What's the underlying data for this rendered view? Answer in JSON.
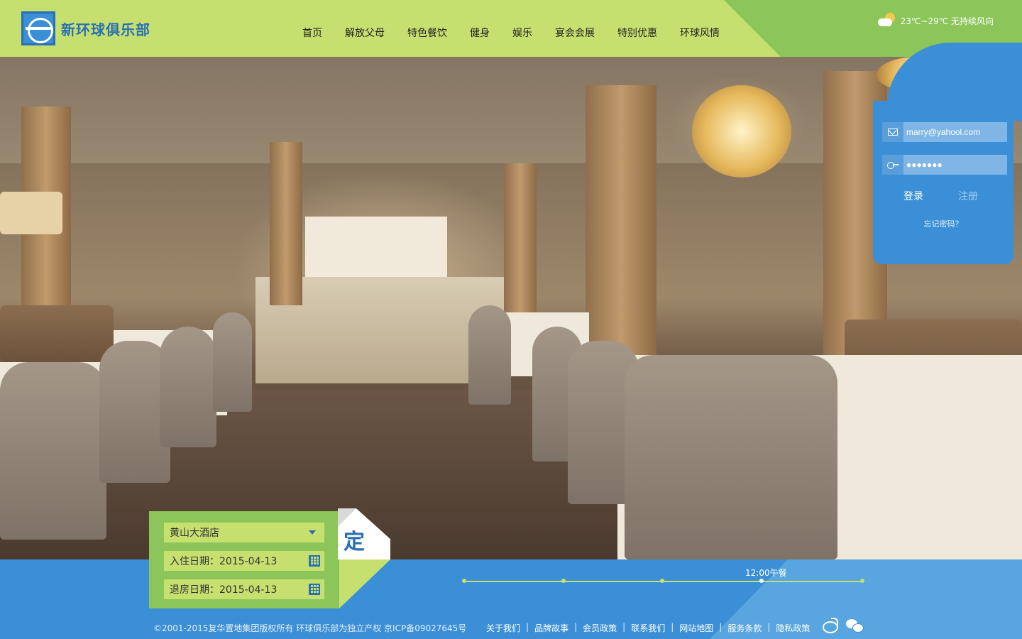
{
  "header": {
    "logo_text": "新环球俱乐部",
    "nav": [
      "首页",
      "解放父母",
      "特色餐饮",
      "健身",
      "娱乐",
      "宴会会展",
      "特别优惠",
      "环球风情"
    ],
    "weather": "23℃~29℃  无持续风向"
  },
  "login": {
    "email_value": "marry@yahool.com",
    "password_value": "●●●●●●●",
    "login_label": "登录",
    "register_label": "注册",
    "forgot_label": "忘记密码？"
  },
  "booking": {
    "hotel": "黄山大酒店",
    "checkin": "入住日期：2015-04-13",
    "checkout": "退房日期：2015-04-13",
    "button_label": "定"
  },
  "timeline": {
    "label": "12:00午餐"
  },
  "footer": {
    "copyright": "©2001-2015复华置地集团版权所有 环球俱乐部为独立产权    京ICP备09027645号",
    "links": [
      "关于我们",
      "品牌故事",
      "会员政策",
      "联系我们",
      "网站地图",
      "服务条款",
      "隐私政策"
    ]
  },
  "colors": {
    "lime": "#c5e06f",
    "green": "#8cc65a",
    "blue": "#3a8fd6",
    "logo_blue": "#2b6fb3"
  },
  "icons": [
    "logo-globe",
    "weather-cloud-sun-icon",
    "mail-icon",
    "key-icon",
    "dropdown-icon",
    "calendar-icon",
    "weibo-icon",
    "wechat-icon"
  ]
}
